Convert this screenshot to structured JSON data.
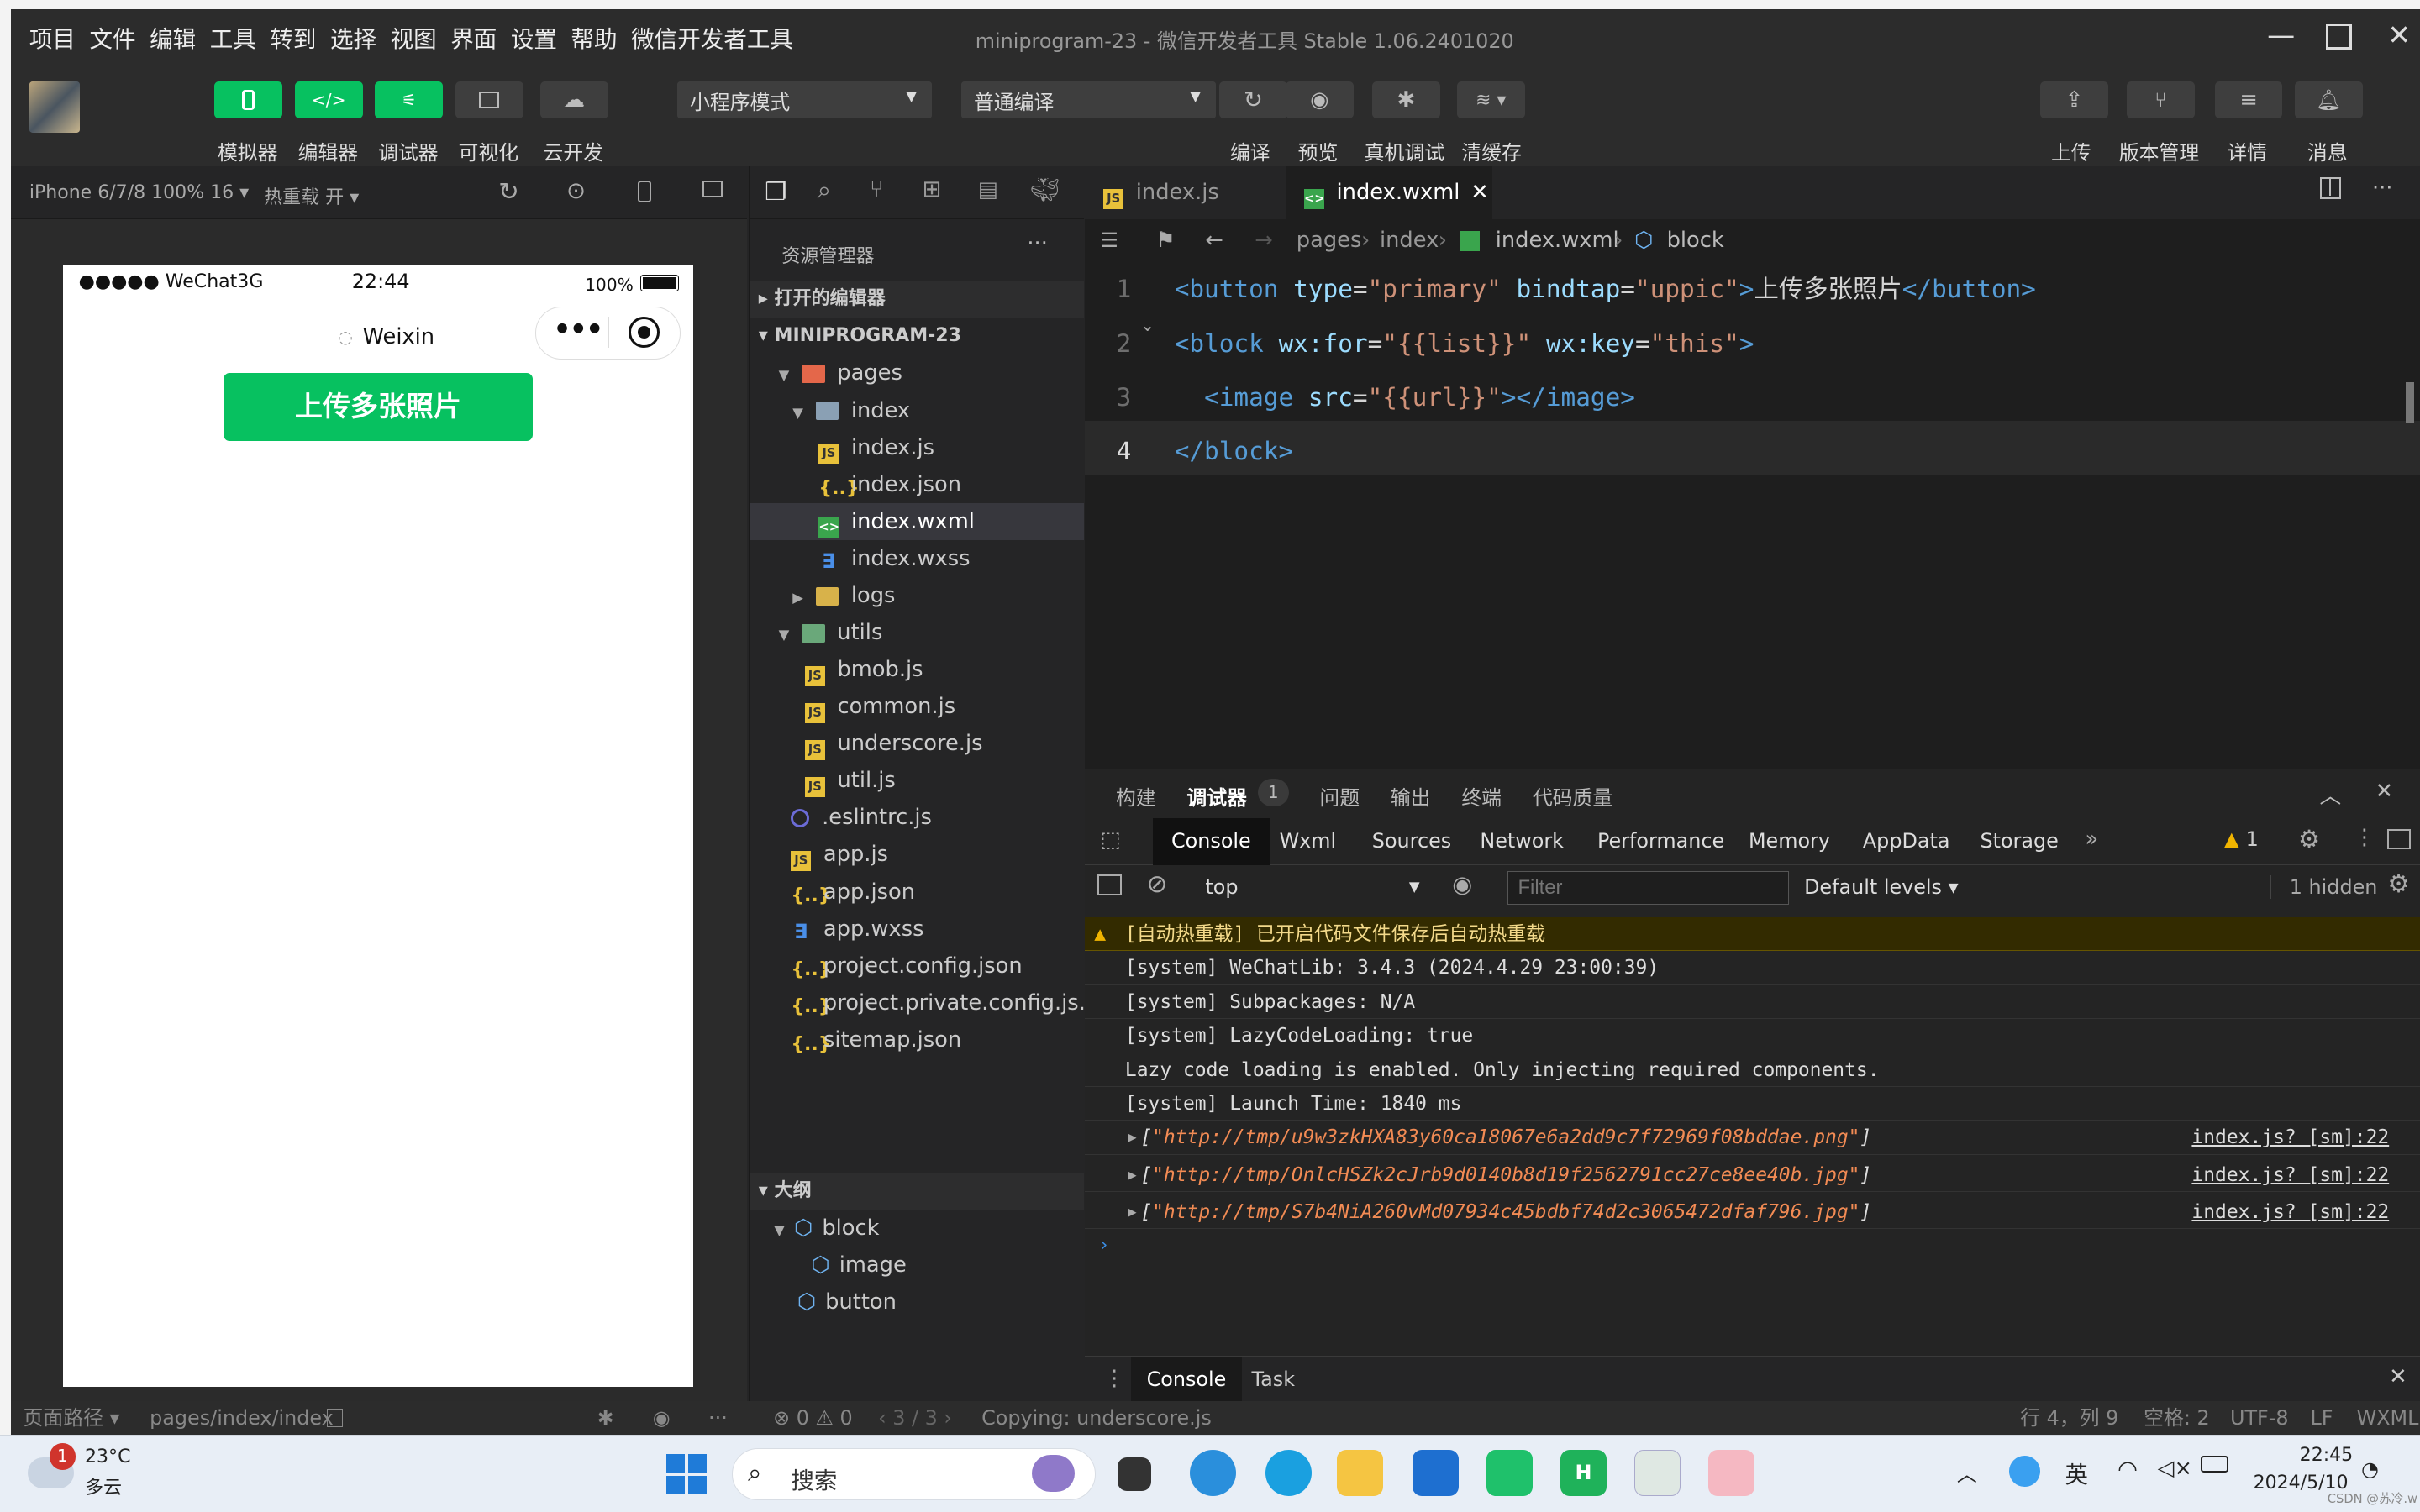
{
  "menu": [
    "项目",
    "文件",
    "编辑",
    "工具",
    "转到",
    "选择",
    "视图",
    "界面",
    "设置",
    "帮助",
    "微信开发者工具"
  ],
  "window_title": "miniprogram-23 - 微信开发者工具 Stable 1.06.2401020",
  "toolbar": {
    "left_buttons": [
      "模拟器",
      "编辑器",
      "调试器",
      "可视化",
      "云开发"
    ],
    "mode_select": "小程序模式",
    "compile_select": "普通编译",
    "mid_buttons": [
      "编译",
      "预览",
      "真机调试",
      "清缓存"
    ],
    "right_buttons": [
      "上传",
      "版本管理",
      "详情",
      "消息"
    ]
  },
  "simulator": {
    "device": "iPhone 6/7/8 100% 16",
    "hot_reload": "热重载 开",
    "carrier": "●●●●● WeChat",
    "network": "3G",
    "time": "22:44",
    "battery": "100%",
    "nav_title": "Weixin",
    "button_label": "上传多张照片"
  },
  "explorer": {
    "title": "资源管理器",
    "open_editors": "打开的编辑器",
    "project": "MINIPROGRAM-23",
    "tree": [
      {
        "name": "pages",
        "kind": "folder-red",
        "level": 1,
        "open": true
      },
      {
        "name": "index",
        "kind": "folder",
        "level": 2,
        "open": true
      },
      {
        "name": "index.js",
        "kind": "js",
        "level": 3
      },
      {
        "name": "index.json",
        "kind": "json",
        "level": 3
      },
      {
        "name": "index.wxml",
        "kind": "wxml",
        "level": 3,
        "selected": true
      },
      {
        "name": "index.wxss",
        "kind": "wxss",
        "level": 3
      },
      {
        "name": "logs",
        "kind": "folder-yellow",
        "level": 2,
        "open": false
      },
      {
        "name": "utils",
        "kind": "folder-green",
        "level": 1,
        "open": true
      },
      {
        "name": "bmob.js",
        "kind": "js",
        "level": 2
      },
      {
        "name": "common.js",
        "kind": "js",
        "level": 2
      },
      {
        "name": "underscore.js",
        "kind": "js",
        "level": 2
      },
      {
        "name": "util.js",
        "kind": "js",
        "level": 2
      },
      {
        "name": ".eslintrc.js",
        "kind": "eslint",
        "level": 1
      },
      {
        "name": "app.js",
        "kind": "js",
        "level": 1
      },
      {
        "name": "app.json",
        "kind": "json",
        "level": 1
      },
      {
        "name": "app.wxss",
        "kind": "wxss",
        "level": 1
      },
      {
        "name": "project.config.json",
        "kind": "json",
        "level": 1
      },
      {
        "name": "project.private.config.js...",
        "kind": "json",
        "level": 1
      },
      {
        "name": "sitemap.json",
        "kind": "json",
        "level": 1
      }
    ],
    "outline_title": "大纲",
    "outline": [
      {
        "name": "block",
        "level": 1
      },
      {
        "name": "image",
        "level": 2
      },
      {
        "name": "button",
        "level": 1
      }
    ]
  },
  "editor": {
    "tabs": [
      {
        "label": "index.js",
        "active": false
      },
      {
        "label": "index.wxml",
        "active": true
      }
    ],
    "breadcrumb": [
      "pages",
      "index",
      "index.wxml",
      "block"
    ],
    "lines": [
      {
        "n": "1",
        "tokens": [
          [
            "tg",
            "<button "
          ],
          [
            "at",
            "type"
          ],
          [
            "tx",
            "="
          ],
          [
            "st",
            "\"primary\""
          ],
          [
            "tx",
            " "
          ],
          [
            "at",
            "bindtap"
          ],
          [
            "tx",
            "="
          ],
          [
            "st",
            "\"uppic\""
          ],
          [
            "tg",
            ">"
          ],
          [
            "tx",
            "上传多张照片"
          ],
          [
            "tg",
            "</button>"
          ]
        ]
      },
      {
        "n": "2",
        "tokens": [
          [
            "tg",
            "<block "
          ],
          [
            "at",
            "wx:for"
          ],
          [
            "tx",
            "="
          ],
          [
            "st",
            "\"{{list}}\""
          ],
          [
            "tx",
            " "
          ],
          [
            "at",
            "wx:key"
          ],
          [
            "tx",
            "="
          ],
          [
            "st",
            "\"this\""
          ],
          [
            "tg",
            ">"
          ]
        ]
      },
      {
        "n": "3",
        "tokens": [
          [
            "tx",
            "  "
          ],
          [
            "tg",
            "<image "
          ],
          [
            "at",
            "src"
          ],
          [
            "tx",
            "="
          ],
          [
            "st",
            "\"{{url}}\""
          ],
          [
            "tg",
            "></image>"
          ]
        ]
      },
      {
        "n": "4",
        "tokens": [
          [
            "tg",
            "</block>"
          ]
        ]
      }
    ]
  },
  "devtools": {
    "top_tabs": [
      "构建",
      "调试器",
      "问题",
      "输出",
      "终端",
      "代码质量"
    ],
    "debugger_badge": "1",
    "panel_tabs": [
      "Console",
      "Wxml",
      "Sources",
      "Network",
      "Performance",
      "Memory",
      "AppData",
      "Storage"
    ],
    "warn_count": "1",
    "context": "top",
    "filter_placeholder": "Filter",
    "levels": "Default levels",
    "hidden": "1 hidden",
    "messages": [
      {
        "type": "warn",
        "text": "[自动热重载] 已开启代码文件保存后自动热重载"
      },
      {
        "type": "log",
        "text": "[system] WeChatLib: 3.4.3 (2024.4.29 23:00:39)"
      },
      {
        "type": "log",
        "text": "[system] Subpackages: N/A"
      },
      {
        "type": "log",
        "text": "[system] LazyCodeLoading: true"
      },
      {
        "type": "log",
        "text": "Lazy code loading is enabled. Only injecting required components."
      },
      {
        "type": "log",
        "text": "[system] Launch Time: 1840 ms"
      },
      {
        "type": "arr",
        "text": "\"http://tmp/u9w3zkHXA83y60ca18067e6a2dd9c7f72969f08bddae.png\"",
        "src": "index.js? [sm]:22"
      },
      {
        "type": "arr",
        "text": "\"http://tmp/OnlcHSZk2cJrb9d0140b8d19f2562791cc27ce8ee40b.jpg\"",
        "src": "index.js? [sm]:22"
      },
      {
        "type": "arr",
        "text": "\"http://tmp/S7b4NiA260vMd07934c45bdbf74d2c3065472dfaf796.jpg\"",
        "src": "index.js? [sm]:22"
      }
    ],
    "drawer_tabs": [
      "Console",
      "Task"
    ]
  },
  "statusbar": {
    "page_path_label": "页面路径",
    "page_path": "pages/index/index",
    "errors": "0",
    "warnings": "0",
    "pager": "3 / 3",
    "task": "Copying: underscore.js",
    "cursor": "行 4，列 9",
    "indent": "空格: 2",
    "encoding": "UTF-8",
    "eol": "LF",
    "lang": "WXML"
  },
  "taskbar": {
    "weather_temp": "23°C",
    "weather_desc": "多云",
    "weather_badge": "1",
    "search": "搜索",
    "ime": "英",
    "time": "22:45",
    "date": "2024/5/10",
    "watermark": "CSDN @苏冷.w"
  }
}
